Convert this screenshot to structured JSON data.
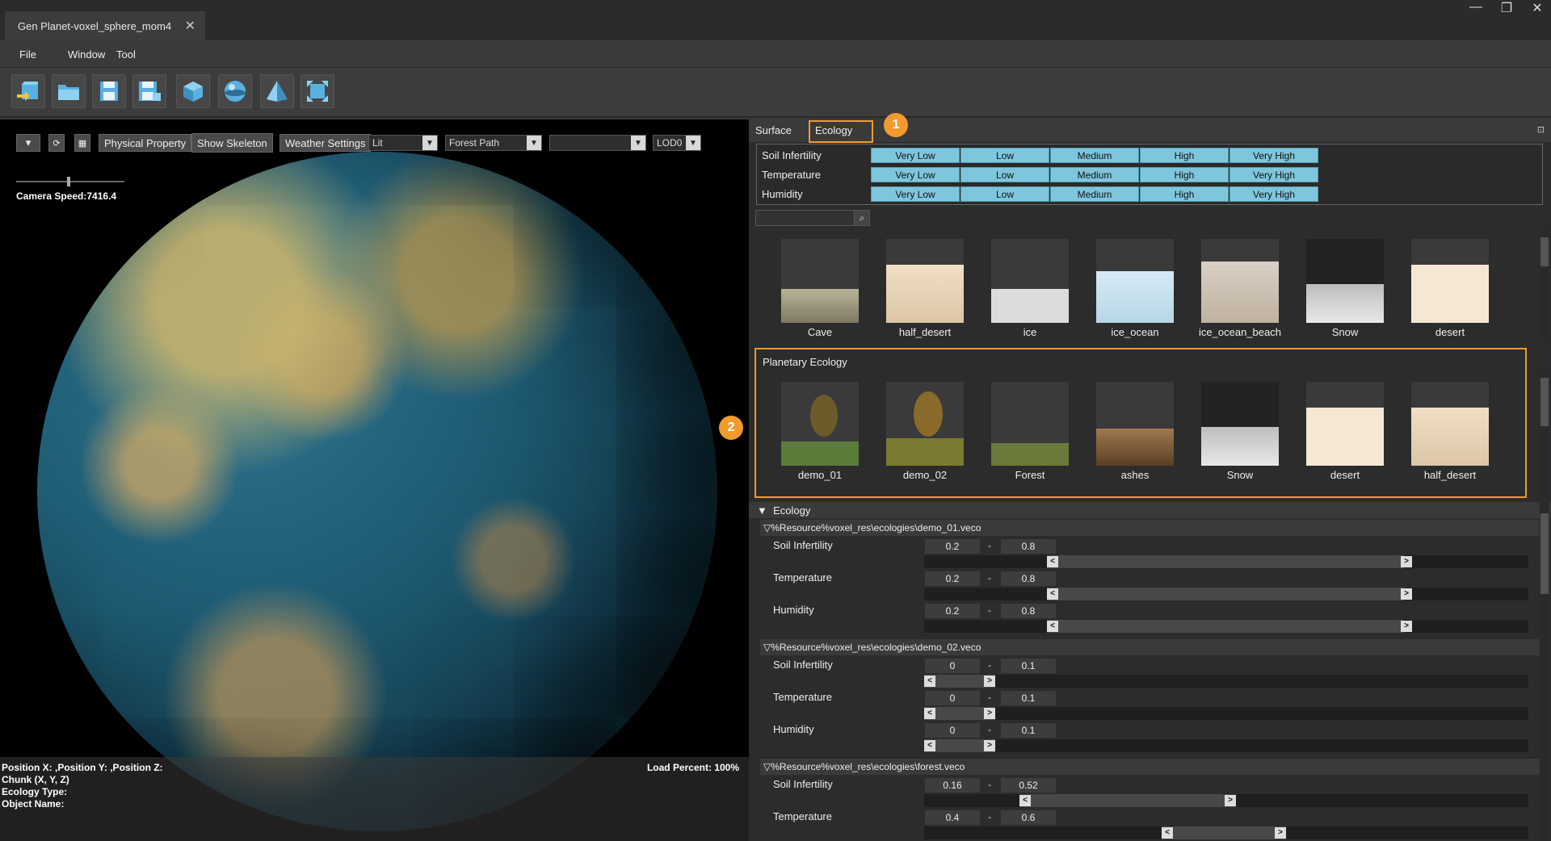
{
  "window": {
    "tab_title": "Gen Planet-voxel_sphere_mom4",
    "close_glyph": "✕",
    "controls": [
      "—",
      "❐",
      "✕"
    ]
  },
  "menu": [
    "File",
    "Window",
    "Tool"
  ],
  "toolbar": {
    "icons": [
      "import-icon",
      "open-folder-icon",
      "save-icon",
      "save-as-icon",
      "cube-icon",
      "sphere-icon",
      "pyramid-icon",
      "fit-view-icon"
    ]
  },
  "viewport": {
    "buttons": {
      "physical_property": "Physical Property",
      "show_skeleton": "Show Skeleton",
      "weather_settings": "Weather Settings"
    },
    "selects": {
      "render_mode": "Lit",
      "path": "Forest Path",
      "empty": "",
      "lod": "LOD0"
    },
    "camera_speed": "Camera Speed:7416.4",
    "camera_speed_level": 0.47,
    "status": {
      "position": "Position X: ,Position Y: ,Position Z:",
      "chunk": "Chunk (X, Y, Z)",
      "ecology_type": "Ecology Type:",
      "object_name": "Object Name:",
      "load_percent": "Load Percent: 100%"
    }
  },
  "callouts": [
    "1",
    "2"
  ],
  "right_panel": {
    "tabs": [
      "Surface",
      "Ecology"
    ],
    "active_tab": "Ecology",
    "pin_glyph": "⊡",
    "conditions": [
      {
        "label": "Soil Infertility",
        "levels": [
          "Very Low",
          "Low",
          "Medium",
          "High",
          "Very High"
        ]
      },
      {
        "label": "Temperature",
        "levels": [
          "Very Low",
          "Low",
          "Medium",
          "High",
          "Very High"
        ]
      },
      {
        "label": "Humidity",
        "levels": [
          "Very Low",
          "Low",
          "Medium",
          "High",
          "Very High"
        ]
      }
    ],
    "search_icon": "⌕",
    "surface_thumbs": [
      "Cave",
      "half_desert",
      "ice",
      "ice_ocean",
      "ice_ocean_beach",
      "Snow",
      "desert"
    ],
    "planetary_ecology_title": "Planetary Ecology",
    "ecology_thumbs": [
      "demo_01",
      "demo_02",
      "Forest",
      "ashes",
      "Snow",
      "desert",
      "half_desert"
    ],
    "ecology_section_title": "Ecology",
    "ecology_files": [
      {
        "path": "%Resource%voxel_res\\ecologies\\demo_01.veco",
        "params": [
          {
            "name": "Soil Infertility",
            "min": "0.2",
            "max": "0.8"
          },
          {
            "name": "Temperature",
            "min": "0.2",
            "max": "0.8"
          },
          {
            "name": "Humidity",
            "min": "0.2",
            "max": "0.8"
          }
        ]
      },
      {
        "path": "%Resource%voxel_res\\ecologies\\demo_02.veco",
        "params": [
          {
            "name": "Soil Infertility",
            "min": "0",
            "max": "0.1"
          },
          {
            "name": "Temperature",
            "min": "0",
            "max": "0.1"
          },
          {
            "name": "Humidity",
            "min": "0",
            "max": "0.1"
          }
        ]
      },
      {
        "path": "%Resource%voxel_res\\ecologies\\forest.veco",
        "params": [
          {
            "name": "Soil Infertility",
            "min": "0.16",
            "max": "0.52"
          },
          {
            "name": "Temperature",
            "min": "0.4",
            "max": "0.6"
          }
        ]
      }
    ],
    "range_left_glyph": "<",
    "range_right_glyph": ">",
    "range_dash": "-"
  },
  "colors": {
    "accent_orange": "#f29a2e",
    "condition_cell": "#7ec6dc"
  }
}
